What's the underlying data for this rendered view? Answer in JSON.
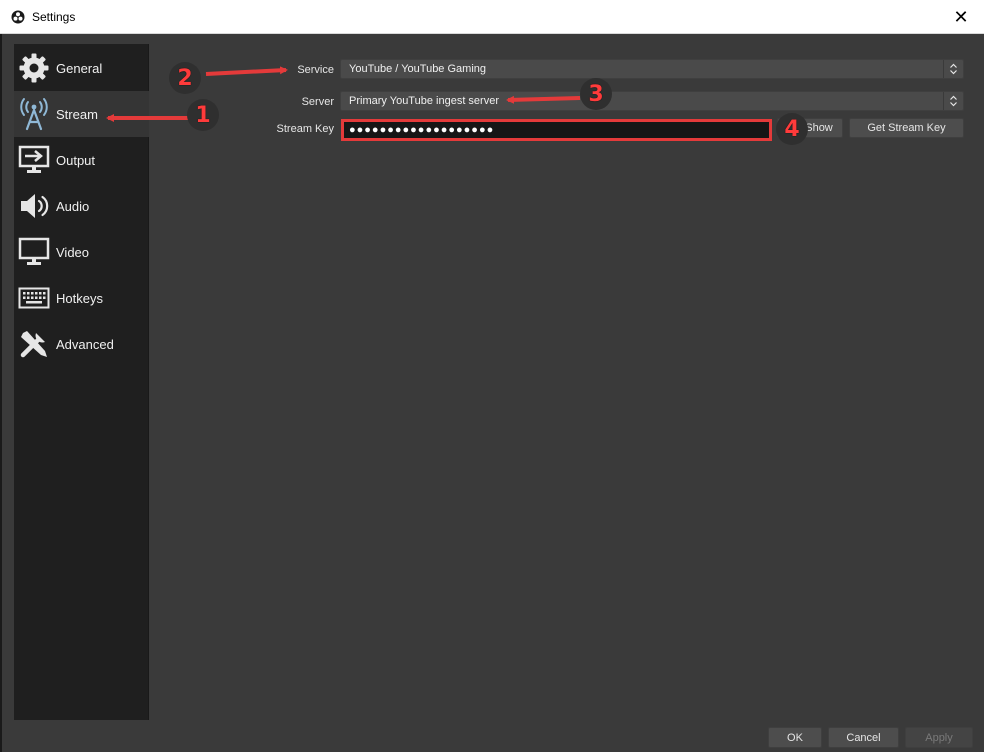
{
  "window": {
    "title": "Settings",
    "close_glyph": "✕",
    "title_icon": "obs-logo-icon"
  },
  "sidebar": {
    "items": [
      {
        "label": "General",
        "icon": "gear-icon",
        "active": false
      },
      {
        "label": "Stream",
        "icon": "antenna-icon",
        "active": true
      },
      {
        "label": "Output",
        "icon": "monitor-output-icon",
        "active": false
      },
      {
        "label": "Audio",
        "icon": "speaker-icon",
        "active": false
      },
      {
        "label": "Video",
        "icon": "monitor-icon",
        "active": false
      },
      {
        "label": "Hotkeys",
        "icon": "keyboard-icon",
        "active": false
      },
      {
        "label": "Advanced",
        "icon": "tools-icon",
        "active": false
      }
    ]
  },
  "stream": {
    "service_label": "Service",
    "service_value": "YouTube / YouTube Gaming",
    "server_label": "Server",
    "server_value": "Primary YouTube ingest server",
    "key_label": "Stream Key",
    "key_value": "●●●●●●●●●●●●●●●●●●●",
    "show_button": "Show",
    "get_key_button": "Get Stream Key"
  },
  "annotations": {
    "markers": [
      "1",
      "2",
      "3",
      "4"
    ],
    "color": "#e43a3a"
  },
  "footer": {
    "ok": "OK",
    "cancel": "Cancel",
    "apply": "Apply"
  },
  "colors": {
    "background": "#3a3a3a",
    "sidebar": "#1f1f1f",
    "accent_red": "#e43a3a"
  }
}
